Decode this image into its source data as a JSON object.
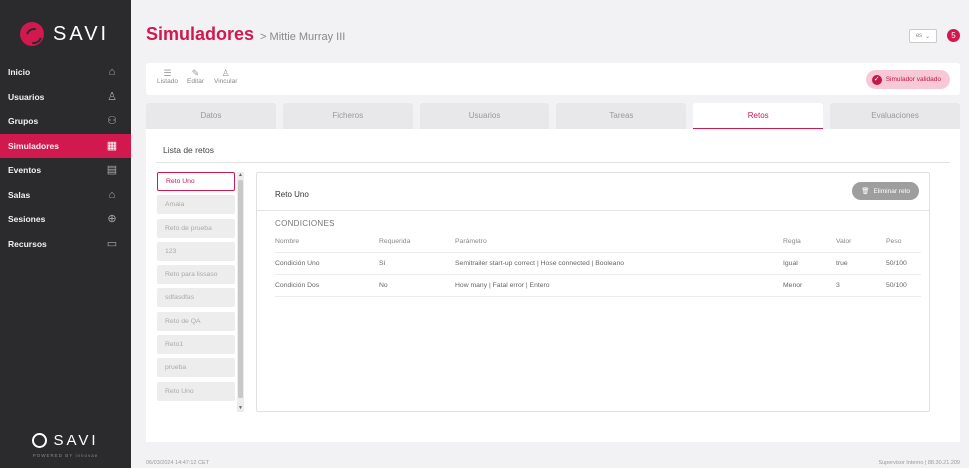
{
  "brand": {
    "name": "SAVI",
    "powered_by": "POWERED BY  innovae"
  },
  "sidebar": {
    "items": [
      {
        "label": "Inicio",
        "icon": "home-icon"
      },
      {
        "label": "Usuarios",
        "icon": "user-icon"
      },
      {
        "label": "Grupos",
        "icon": "group-icon"
      },
      {
        "label": "Simuladores",
        "icon": "grid-icon",
        "active": true
      },
      {
        "label": "Eventos",
        "icon": "calendar-icon"
      },
      {
        "label": "Salas",
        "icon": "building-icon"
      },
      {
        "label": "Sesiones",
        "icon": "login-icon"
      },
      {
        "label": "Recursos",
        "icon": "archive-icon"
      }
    ]
  },
  "header": {
    "title": "Simuladores",
    "separator": ">",
    "breadcrumb": "Mittie Murray III",
    "lang": "es",
    "notifications": "5"
  },
  "toolbar": {
    "listado": "Listado",
    "editar": "Editar",
    "vincular": "Vincular",
    "status": "Simulador validado"
  },
  "tabs": [
    "Datos",
    "Ficheros",
    "Usuarios",
    "Tareas",
    "Retos",
    "Evaluaciones"
  ],
  "active_tab": "Retos",
  "retos": {
    "title": "Lista de retos",
    "items": [
      "Reto Uno",
      "Amaia",
      "Reto de prueba",
      "123",
      "Reto para lissaso",
      "sdfasdfas",
      "Reto de QA",
      "Reto1",
      "prueba",
      "Reto Uno"
    ]
  },
  "detail": {
    "title": "Reto Uno",
    "delete_label": "Eliminar reto",
    "conditions_title": "CONDICIONES",
    "columns": [
      "Nombre",
      "Requerida",
      "Parámetro",
      "Regla",
      "Valor",
      "Peso"
    ],
    "rows": [
      [
        "Condición Uno",
        "Sí",
        "Semitrailer start-up correct | Hose connected | Booleano",
        "Igual",
        "true",
        "50/100"
      ],
      [
        "Condición Dos",
        "No",
        "How many | Fatal error | Entero",
        "Menor",
        "3",
        "50/100"
      ]
    ]
  },
  "footer": {
    "timestamp": "06/03/2024 14:47:12 CET",
    "version": "Supervisor Interno | 88.30.21.209"
  },
  "colors": {
    "accent": "#d1184f",
    "sidebar": "#2b2b2d",
    "background": "#f2f2f4"
  }
}
